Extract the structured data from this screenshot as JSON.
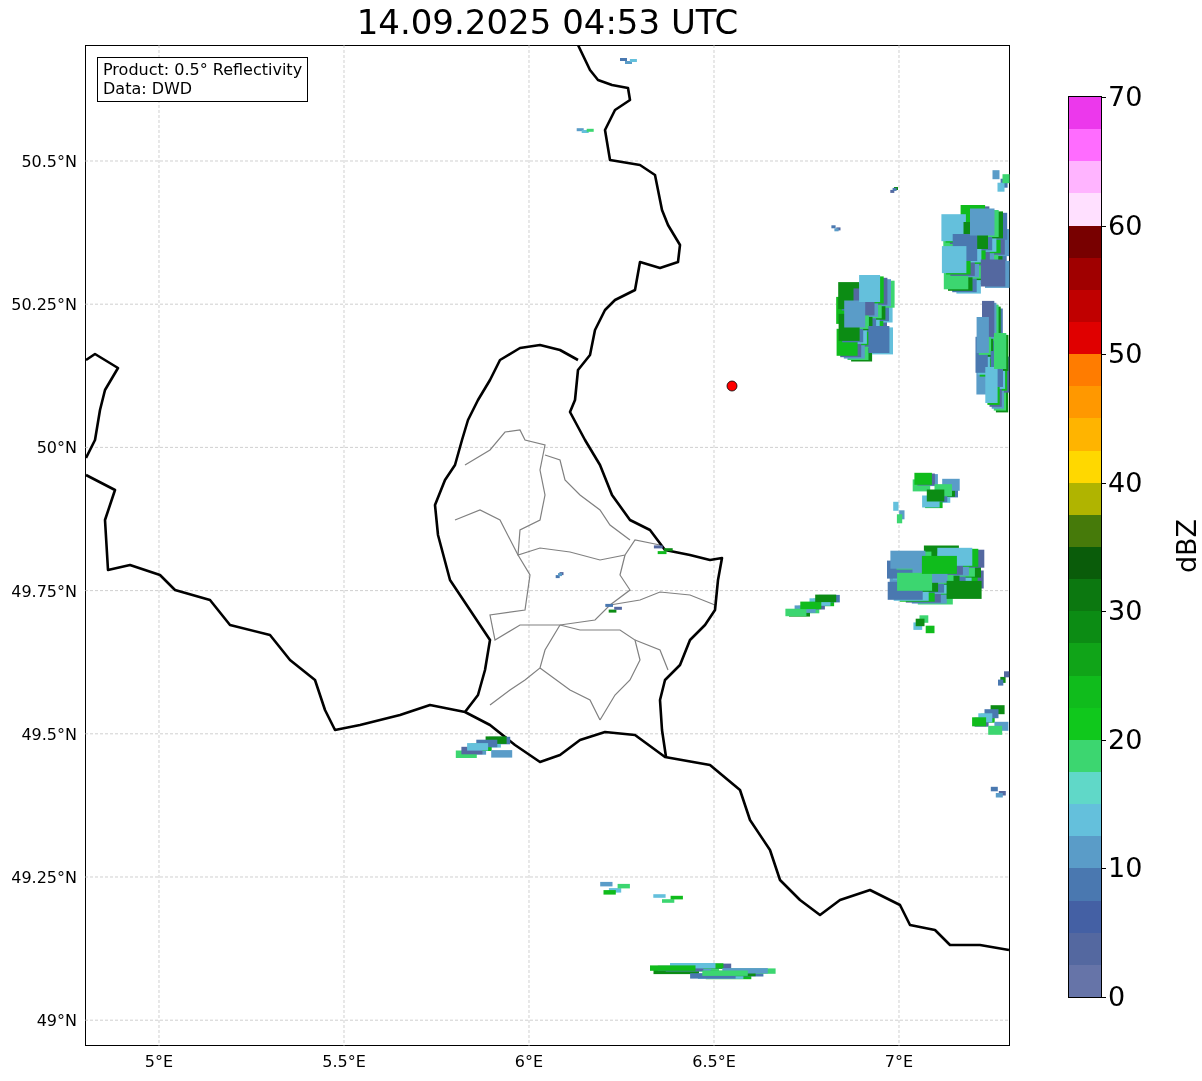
{
  "title": "14.09.2025 04:53 UTC",
  "info_box": [
    "Product: 0.5° Reflectivity",
    "Data: DWD"
  ],
  "map": {
    "lat_ticks": [
      "50.5°N",
      "50.25°N",
      "50°N",
      "49.75°N",
      "49.5°N",
      "49.25°N",
      "49°N"
    ],
    "lon_ticks": [
      "5°E",
      "5.5°E",
      "6°E",
      "6.5°E",
      "7°E"
    ]
  },
  "colorbar": {
    "label": "dBZ",
    "ticks": [
      "70",
      "60",
      "50",
      "40",
      "30",
      "20",
      "10",
      "0"
    ],
    "bands": [
      {
        "color": "#ec38ec"
      },
      {
        "color": "#ff6cff"
      },
      {
        "color": "#ffb4ff"
      },
      {
        "color": "#ffe0ff"
      },
      {
        "color": "#780000"
      },
      {
        "color": "#a00000"
      },
      {
        "color": "#c00000"
      },
      {
        "color": "#e00000"
      },
      {
        "color": "#ff7c00"
      },
      {
        "color": "#ff9800"
      },
      {
        "color": "#ffb400"
      },
      {
        "color": "#ffd800"
      },
      {
        "color": "#b0b400"
      },
      {
        "color": "#467a0a"
      },
      {
        "color": "#0a5c0a"
      },
      {
        "color": "#0c7810"
      },
      {
        "color": "#0c8c14"
      },
      {
        "color": "#10a418"
      },
      {
        "color": "#10bc1c"
      },
      {
        "color": "#10c81c"
      },
      {
        "color": "#3cd670"
      },
      {
        "color": "#60d8c8"
      },
      {
        "color": "#64c0dc"
      },
      {
        "color": "#5a9cc8"
      },
      {
        "color": "#4a78b0"
      },
      {
        "color": "#4460a4"
      },
      {
        "color": "#5468a0"
      },
      {
        "color": "#6674a8"
      }
    ]
  }
}
